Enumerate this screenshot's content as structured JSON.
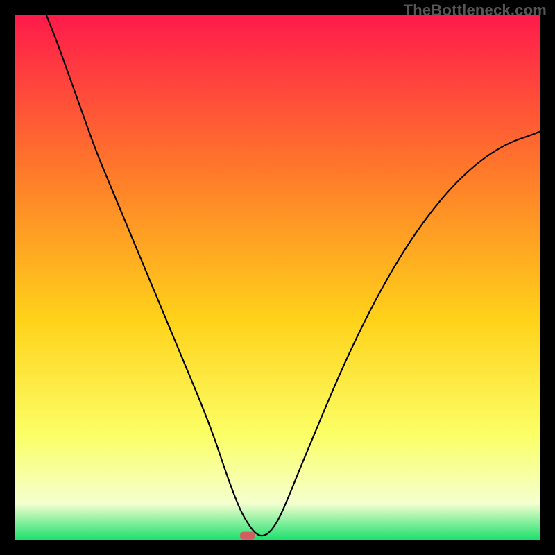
{
  "watermark": "TheBottleneck.com",
  "colors": {
    "frame": "#000000",
    "gradient_top": "#ff1a4b",
    "gradient_mid1": "#ff7a2a",
    "gradient_mid2": "#ffd21a",
    "gradient_mid3": "#fbff66",
    "gradient_band": "#f4ffcf",
    "gradient_bottom": "#18e06c",
    "curve_stroke": "#000000",
    "marker_fill": "#d25f5f"
  },
  "chart_data": {
    "type": "line",
    "title": "",
    "xlabel": "",
    "ylabel": "",
    "xlim": [
      0,
      100
    ],
    "ylim": [
      0,
      100
    ],
    "grid": false,
    "series": [
      {
        "name": "bottleneck-curve",
        "x": [
          6,
          8,
          10.5,
          13,
          15.5,
          18,
          20.5,
          23,
          25.5,
          28,
          30.5,
          33,
          35.5,
          38,
          40,
          41.8,
          43.5,
          46,
          48,
          50,
          52,
          54,
          56.5,
          59,
          62,
          65,
          68,
          71,
          74,
          77,
          80,
          83,
          86,
          89,
          92,
          95,
          98,
          100
        ],
        "y": [
          100,
          95,
          88,
          81,
          74,
          68,
          62,
          56,
          50,
          44,
          38,
          32,
          26,
          19.5,
          13.5,
          8.5,
          4.5,
          0.9,
          0.9,
          3.5,
          8,
          13,
          19,
          25,
          32,
          38.5,
          44.5,
          50,
          55,
          59.5,
          63.5,
          67,
          70,
          72.5,
          74.5,
          76,
          77,
          77.8
        ]
      }
    ],
    "marker": {
      "x": 44.3,
      "y": 0.9,
      "label": "optimal-point"
    },
    "flat_region": {
      "x_start": 41.8,
      "x_end": 46.8,
      "y": 0.9
    }
  }
}
